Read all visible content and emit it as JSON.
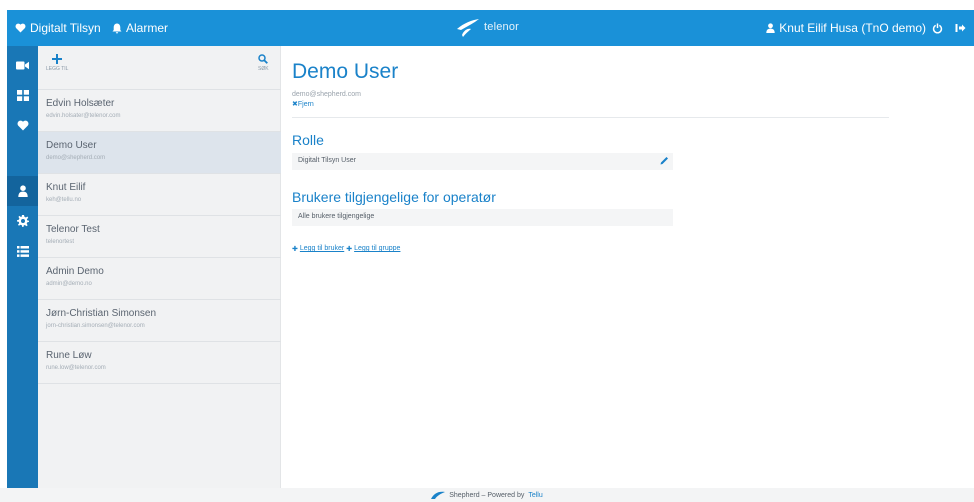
{
  "topbar": {
    "nav_digital": "Digitalt Tilsyn",
    "nav_alarms": "Alarmer",
    "brand": "telenor",
    "user_name": "Knut Eilif Husa (TnO demo)"
  },
  "rail": {
    "items": [
      {
        "icon": "video-icon"
      },
      {
        "icon": "dashboard-icon"
      },
      {
        "icon": "heart-icon"
      },
      {
        "icon": "user-icon"
      },
      {
        "icon": "cog-icon"
      },
      {
        "icon": "list-icon"
      }
    ],
    "active_index": 3
  },
  "userlist": {
    "add_label": "LEGG TIL",
    "search_label": "SØK",
    "users": [
      {
        "name": "Edvin Holsæter",
        "email": "edvin.holsater@telenor.com"
      },
      {
        "name": "Demo User",
        "email": "demo@shepherd.com"
      },
      {
        "name": "Knut Eilif",
        "email": "keh@tellu.no"
      },
      {
        "name": "Telenor Test",
        "email": "telenortest"
      },
      {
        "name": "Admin Demo",
        "email": "admin@demo.no"
      },
      {
        "name": "Jørn-Christian Simonsen",
        "email": "jorn-christian.simonsen@telenor.com"
      },
      {
        "name": "Rune Løw",
        "email": "rune.low@telenor.com"
      }
    ],
    "selected_index": 1
  },
  "detail": {
    "title": "Demo User",
    "email": "demo@shepherd.com",
    "remove_label": "Fjern",
    "role_heading": "Rolle",
    "role_value": "Digitalt Tilsyn User",
    "access_heading": "Brukere tilgjengelige for operatør",
    "access_value": "Alle brukere tilgjengelige",
    "add_user_link": "Legg til bruker",
    "add_group_link": "Legg til gruppe"
  },
  "footer": {
    "text": "Shepherd – Powered by",
    "link": "Tellu"
  },
  "colors": {
    "topbar": "#1a91d8",
    "rail": "#1977b6",
    "accent": "#1a82c9",
    "list_bg": "#f1f2f3",
    "selected_row": "#dde4ec"
  }
}
